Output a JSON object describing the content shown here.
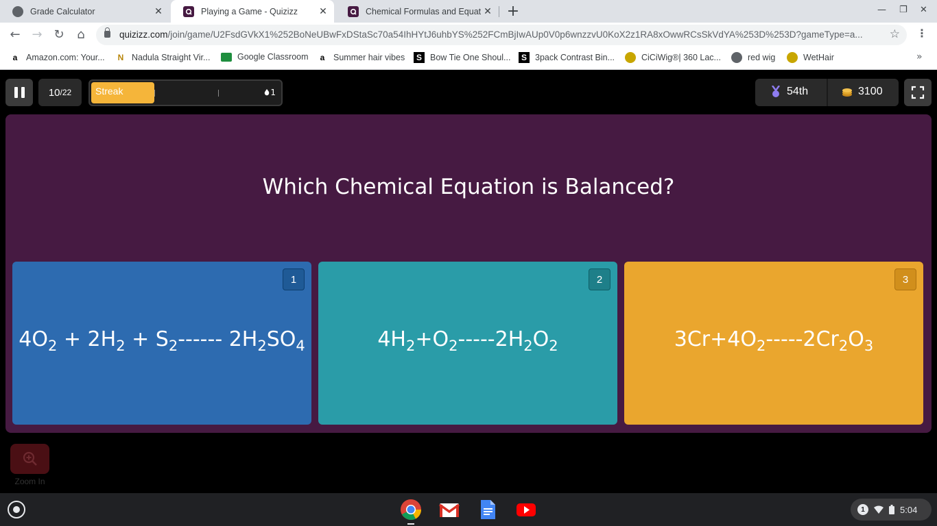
{
  "browser": {
    "tabs": [
      {
        "title": "Grade Calculator",
        "icon": "globe-icon"
      },
      {
        "title": "Playing a Game - Quizizz",
        "icon": "quizizz-icon"
      },
      {
        "title": "Chemical Formulas and Equatio",
        "icon": "quizizz-icon"
      }
    ],
    "url_main": "quizizz.com",
    "url_rest": "/join/game/U2FsdGVkX1%252BoNeUBwFxDStaSc70a54IhHYtJ6uhbYS%252FCmBjIwAUp0V0p6wnzzvU0KoX2z1RA8xOwwRCsSkVdYA%253D%253D?gameType=a...",
    "bookmarks": [
      {
        "label": "Amazon.com: Your...",
        "icon": "amazon-icon"
      },
      {
        "label": "Nadula Straight Vir...",
        "icon": "nadula-icon"
      },
      {
        "label": "Google Classroom",
        "icon": "classroom-icon"
      },
      {
        "label": "Summer hair vibes",
        "icon": "amazon-icon"
      },
      {
        "label": "Bow Tie One Shoul...",
        "icon": "s-icon"
      },
      {
        "label": "3pack Contrast Bin...",
        "icon": "s-icon"
      },
      {
        "label": "CiCiWig®| 360 Lac...",
        "icon": "leaf-icon"
      },
      {
        "label": "red wig",
        "icon": "globe-icon"
      },
      {
        "label": "WetHair",
        "icon": "leaf-icon"
      }
    ]
  },
  "game": {
    "question_number": "10",
    "question_total": "/22",
    "streak_label": "Streak",
    "streak_fill": 0.33,
    "streak_count": "1",
    "rank": "54th",
    "coins": "3100",
    "question": "Which Chemical Equation is Balanced?",
    "zoom_label": "Zoom In",
    "colors": {
      "panel": "#461a42",
      "option1": "#2d6bb0",
      "option2": "#2a9ca8",
      "option3": "#eaa62e"
    },
    "options": [
      {
        "number": "1",
        "parts": [
          "4O",
          "2",
          " + 2H",
          "2",
          " + S",
          "2",
          "------ 2H",
          "2",
          "SO",
          "4"
        ]
      },
      {
        "number": "2",
        "parts": [
          "4H",
          "2",
          "+O",
          "2",
          "-----2H",
          "2",
          "O",
          "2"
        ]
      },
      {
        "number": "3",
        "parts": [
          "3Cr+4O",
          "2",
          "-----2Cr",
          "2",
          "O",
          "3"
        ]
      }
    ]
  },
  "shelf": {
    "apps": [
      "chrome-icon",
      "gmail-icon",
      "docs-icon",
      "youtube-icon"
    ],
    "notification_count": "1",
    "time": "5:04"
  }
}
